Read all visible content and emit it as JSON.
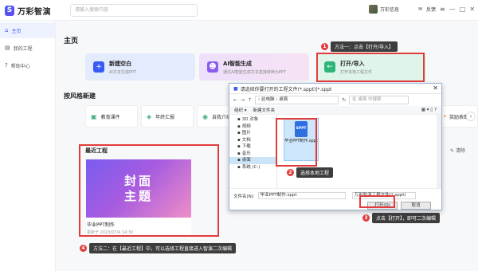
{
  "app": {
    "name": "万彩智演",
    "logo_letter": "S"
  },
  "search": {
    "placeholder": "请输入搜索内容"
  },
  "topbar": {
    "user_name": "万彩信息",
    "feedback": "反馈",
    "menu_icon": "menu-icon",
    "min_icon": "minimize-icon",
    "max_icon": "maximize-icon",
    "close_icon": "close-icon"
  },
  "sidebar": {
    "items": [
      {
        "icon": "⌂",
        "label": "主页",
        "active": true
      },
      {
        "icon": "▤",
        "label": "我的工程",
        "active": false
      },
      {
        "icon": "?",
        "label": "帮助中心",
        "active": false
      }
    ]
  },
  "home": {
    "title": "主页",
    "cards": [
      {
        "icon": "+",
        "title": "新建空白",
        "subtitle": "AI文本生成PPT"
      },
      {
        "icon": "☻",
        "title": "AI智能生成",
        "subtitle": "通过AI智能生成文本直接转换为PPT"
      },
      {
        "icon": "←",
        "title": "打开/导入",
        "subtitle": "打开本地工程文件"
      }
    ],
    "style_title": "按风格新建",
    "styles": [
      "教育课件",
      "年终汇报",
      "自我介绍"
    ],
    "style_last": "奖励表彰",
    "recent_title": "最近工程",
    "clear_label": "清除",
    "recent": {
      "thumb_line1": "封面",
      "thumb_line2": "主题",
      "name": "毕业PPT制作",
      "date": "更新于 2023/07/4 14:30"
    }
  },
  "callouts": {
    "c1": {
      "num": "1",
      "text": "方法一：点击【打开/导入】"
    },
    "c2": {
      "num": "2",
      "text": "选择本地工程"
    },
    "c3": {
      "num": "3",
      "text": "点击【打开】，即可二次编辑"
    },
    "c4": {
      "num": "4",
      "text": "方法二：在【最近工程】中，可以选择工程直接进入智演二次编辑"
    }
  },
  "dialog": {
    "title": "请选择你要打开的工程文件(*.sppt)|*.sppt",
    "address": "› 此电脑 › 桌面",
    "search_placeholder": "在 桌面 中搜索",
    "toolbar_org": "组织 ▾",
    "toolbar_new": "新建文件夹",
    "tree": [
      "3D 对象",
      "视频",
      "图片",
      "文档",
      "下载",
      "音乐",
      "桌面",
      "系统 (C:)"
    ],
    "file_badge": "SPPT",
    "file_name": "毕业PPT制作.sppt",
    "filename_label": "文件名(N):",
    "filename_value": "毕业PPT制作.sppt",
    "filetype_value": "万彩智演工程文件(*.sppt)",
    "open_label": "打开(O)",
    "cancel_label": "取消"
  }
}
